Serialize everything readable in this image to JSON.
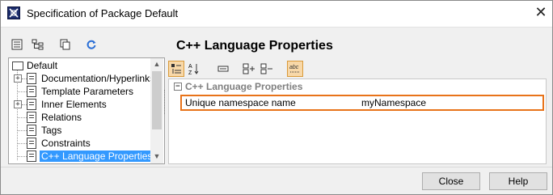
{
  "window": {
    "title": "Specification of Package Default",
    "close_glyph": "✕"
  },
  "left_toolbar": {
    "icons": [
      "properties-view-icon",
      "tree-view-icon",
      "copy-icon",
      "refresh-icon"
    ]
  },
  "tree": {
    "items": [
      {
        "label": "Default",
        "kind": "folder",
        "expandable": false
      },
      {
        "label": "Documentation/Hyperlinks",
        "kind": "doc",
        "expandable": true
      },
      {
        "label": "Template Parameters",
        "kind": "doc",
        "expandable": false
      },
      {
        "label": "Inner Elements",
        "kind": "doc",
        "expandable": true
      },
      {
        "label": "Relations",
        "kind": "doc",
        "expandable": false
      },
      {
        "label": "Tags",
        "kind": "doc",
        "expandable": false
      },
      {
        "label": "Constraints",
        "kind": "doc",
        "expandable": false
      },
      {
        "label": "C++ Language Properties",
        "kind": "doc",
        "expandable": false,
        "selected": true
      }
    ]
  },
  "right_pane": {
    "title": "C++ Language Properties",
    "toolbar_icons": [
      "categorized-icon",
      "sort-alpha-icon",
      "collapse-icon",
      "expand-all-icon",
      "collapse-all-icon",
      "spell-check-icon"
    ],
    "group": {
      "label": "C++ Language Properties",
      "expander": "−"
    },
    "properties": [
      {
        "name": "Unique namespace name",
        "value": "myNamespace"
      }
    ]
  },
  "buttons": {
    "close": "Close",
    "help": "Help"
  },
  "colors": {
    "selection": "#3399ff",
    "highlight_border": "#e8731a",
    "active_toggle": "#f8d8a8"
  }
}
